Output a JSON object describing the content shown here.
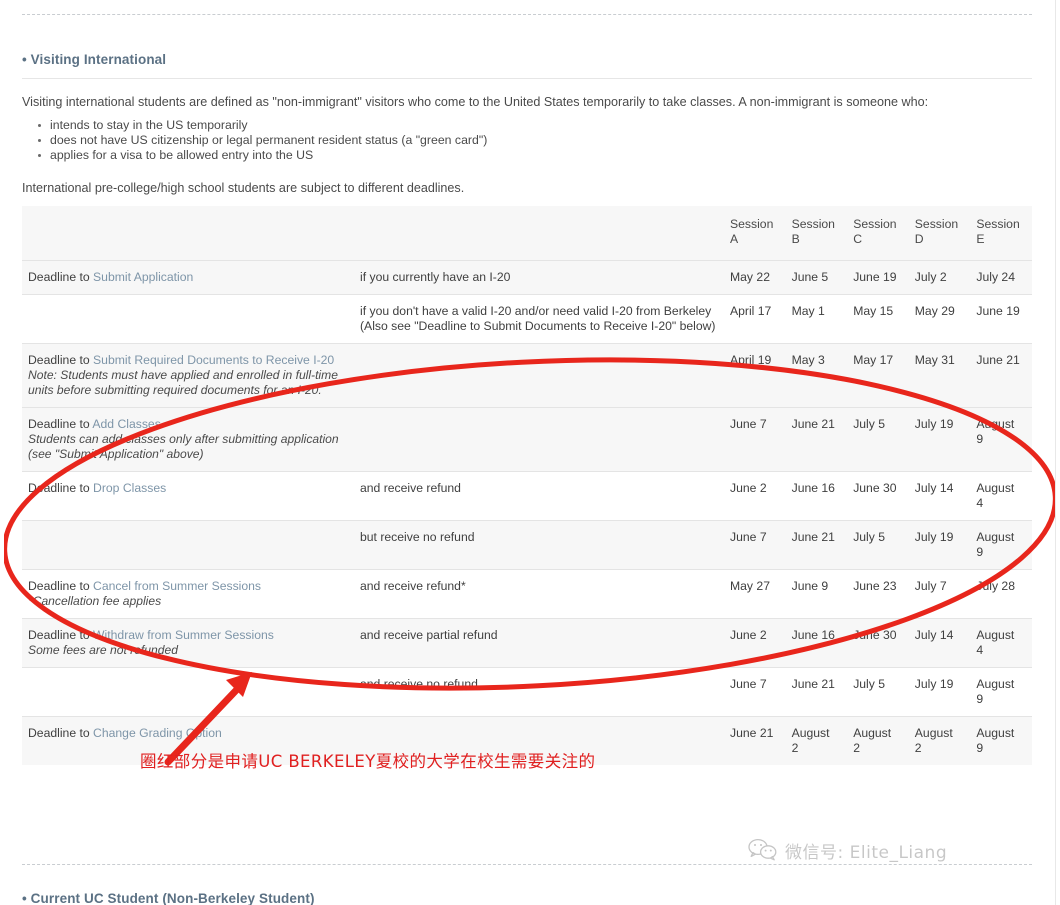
{
  "section": {
    "visiting_heading": "• Visiting International",
    "current_heading": "• Current UC Student (Non-Berkeley Student)"
  },
  "intro": {
    "paragraph": "Visiting international students are defined as \"non-immigrant\" visitors who come to the United States temporarily to take classes. A non-immigrant is someone who:",
    "bullets": [
      "intends to stay in the US temporarily",
      "does not have US citizenship or legal permanent resident status (a \"green card\")",
      "applies for a visa to be allowed entry into the US"
    ],
    "tail": "International pre-college/high school students are subject to different deadlines."
  },
  "table": {
    "headers": [
      "",
      "",
      "Session A",
      "Session B",
      "Session C",
      "Session D",
      "Session E"
    ],
    "rows": [
      {
        "label_lead": "Deadline to ",
        "label_link": "Submit Application",
        "note": "",
        "condition": "if you currently have an I-20",
        "dates": [
          "May 22",
          "June 5",
          "June 19",
          "July 2",
          "July 24"
        ]
      },
      {
        "label_lead": "",
        "label_link": "",
        "note": "",
        "condition": "if you don't have a valid I-20 and/or need valid I-20 from Berkeley (Also see \"Deadline to Submit Documents to Receive I-20\" below)",
        "dates": [
          "April 17",
          "May 1",
          "May 15",
          "May 29",
          "June 19"
        ]
      },
      {
        "label_lead": "Deadline to ",
        "label_link": "Submit Required Documents to Receive I-20",
        "note": "Note: Students must have applied and enrolled in full-time units before submitting required documents for an I-20.",
        "condition": "",
        "dates": [
          "April 19",
          "May 3",
          "May 17",
          "May 31",
          "June 21"
        ]
      },
      {
        "label_lead": "Deadline to ",
        "label_link": "Add Classes",
        "note": "Students can add classes only after submitting application (see \"Submit Application\" above)",
        "condition": "",
        "dates": [
          "June 7",
          "June 21",
          "July 5",
          "July 19",
          "August 9"
        ]
      },
      {
        "label_lead": "Deadline to ",
        "label_link": "Drop Classes",
        "note": "",
        "condition": "and receive refund",
        "dates": [
          "June 2",
          "June 16",
          "June 30",
          "July 14",
          "August 4"
        ]
      },
      {
        "label_lead": "",
        "label_link": "",
        "note": "",
        "condition": "but receive no refund",
        "dates": [
          "June 7",
          "June 21",
          "July 5",
          "July 19",
          "August 9"
        ]
      },
      {
        "label_lead": "Deadline to ",
        "label_link": "Cancel from Summer Sessions",
        "note": "*Cancellation fee applies",
        "condition": "and receive refund*",
        "dates": [
          "May 27",
          "June 9",
          "June 23",
          "July 7",
          "July 28"
        ]
      },
      {
        "label_lead": "Deadline to ",
        "label_link": "Withdraw from Summer Sessions",
        "note": "Some fees are not refunded",
        "condition": "and receive partial refund",
        "dates": [
          "June 2",
          "June 16",
          "June 30",
          "July 14",
          "August 4"
        ]
      },
      {
        "label_lead": "",
        "label_link": "",
        "note": "",
        "condition": "and receive no refund",
        "dates": [
          "June 7",
          "June 21",
          "July 5",
          "July 19",
          "August 9"
        ]
      },
      {
        "label_lead": "Deadline to ",
        "label_link": "Change Grading Option",
        "note": "",
        "condition": "",
        "dates": [
          "June 21",
          "August 2",
          "August 2",
          "August 2",
          "August 9"
        ]
      }
    ]
  },
  "annotation": {
    "chinese_note": "圈红部分是申请UC BERKELEY夏校的大学在校生需要关注的",
    "color": "#e02020",
    "ellipse_label": "red-highlight-ellipse",
    "arrow_label": "red-arrow"
  },
  "watermark": {
    "text": "微信号: Elite_Liang",
    "icon": "wechat-icon"
  }
}
